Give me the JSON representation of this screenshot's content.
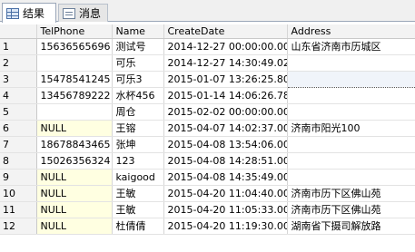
{
  "tabs": [
    {
      "label": "结果",
      "icon": "grid-icon",
      "active": true
    },
    {
      "label": "消息",
      "icon": "message-icon",
      "active": false
    }
  ],
  "grid": {
    "columns": [
      "TelPhone",
      "Name",
      "CreateDate",
      "Address"
    ],
    "rows": [
      {
        "num": "1",
        "tel": "15636565696",
        "name": "测试号",
        "date": "2014-12-27 00:00:00.000",
        "addr": "山东省济南市历城区"
      },
      {
        "num": "2",
        "tel": "",
        "name": "可乐",
        "date": "2014-12-27 14:30:49.023",
        "addr": ""
      },
      {
        "num": "3",
        "tel": "15478541245",
        "name": "可乐3",
        "date": "2015-01-07 13:26:25.800",
        "addr": ""
      },
      {
        "num": "4",
        "tel": "13456789222",
        "name": "水杯456",
        "date": "2015-01-14 14:06:26.783",
        "addr": ""
      },
      {
        "num": "5",
        "tel": "",
        "name": "周仓",
        "date": "2015-02-02 00:00:00.000",
        "addr": ""
      },
      {
        "num": "6",
        "tel": "NULL",
        "name": "王镕",
        "date": "2015-04-07 14:02:37.000",
        "addr": "济南市阳光100"
      },
      {
        "num": "7",
        "tel": "18678843465",
        "name": "张坤",
        "date": "2015-04-08 13:54:06.000",
        "addr": ""
      },
      {
        "num": "8",
        "tel": "15026356324",
        "name": "123",
        "date": "2015-04-08 14:28:51.000",
        "addr": ""
      },
      {
        "num": "9",
        "tel": "NULL",
        "name": "kaigood",
        "date": "2015-04-08 14:35:49.000",
        "addr": ""
      },
      {
        "num": "10",
        "tel": "NULL",
        "name": "王敏",
        "date": "2015-04-20 11:04:40.000",
        "addr": "济南市历下区佛山苑"
      },
      {
        "num": "11",
        "tel": "NULL",
        "name": "王敏",
        "date": "2015-04-20 11:05:33.000",
        "addr": "济南市历下区佛山苑"
      },
      {
        "num": "12",
        "tel": "NULL",
        "name": "杜倩倩",
        "date": "2015-04-20 11:19:30.000",
        "addr": "湖南省下摄司解放路"
      }
    ]
  },
  "selected_cell": {
    "row": 3,
    "column": "Address"
  },
  "colors": {
    "null_cell": "#ffffe1",
    "header_bg": "#f3f3f3"
  }
}
